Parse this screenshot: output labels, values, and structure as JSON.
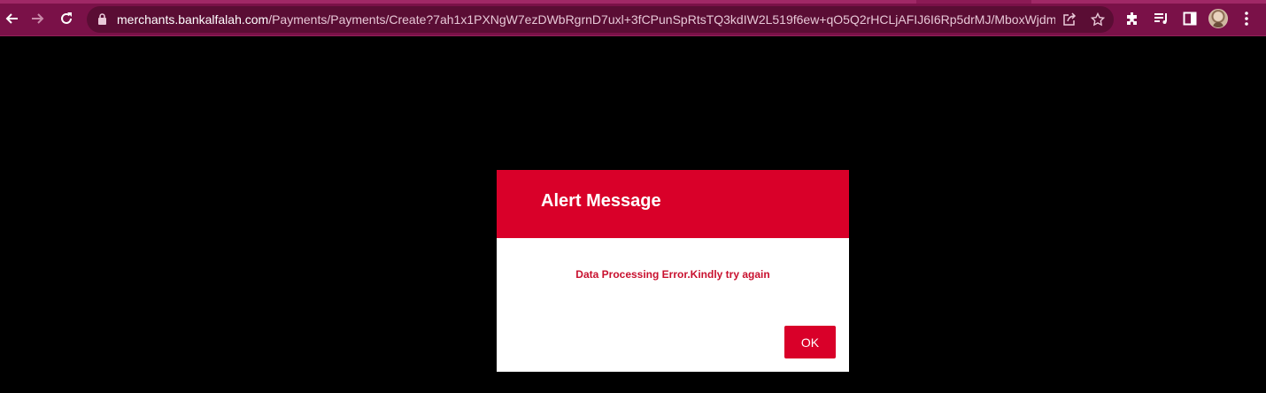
{
  "browser": {
    "url_host": "merchants.bankalfalah.com",
    "url_path": "/Payments/Payments/Create?7ah1x1PXNgW7ezDWbRgrnD7uxl+3fCPunSpRtsTQ3kdIW2L519f6ew+qO5Q2rHCLjAFIJ6I6Rp5drMJ/MboxWjdmE8...",
    "icons": [
      "back-arrow-icon",
      "forward-arrow-icon",
      "reload-icon",
      "lock-icon",
      "share-icon",
      "star-icon",
      "extensions-icon",
      "media-controls-icon",
      "side-panel-icon",
      "avatar",
      "kebab-menu-icon"
    ],
    "colors": {
      "toolbar": "#7a1148",
      "omnibox": "#5a0d34"
    }
  },
  "modal": {
    "title": "Alert Message",
    "message": "Data Processing Error.Kindly try again",
    "ok_label": "OK",
    "colors": {
      "header": "#d90029",
      "message": "#c8102e",
      "button": "#d90029"
    }
  }
}
